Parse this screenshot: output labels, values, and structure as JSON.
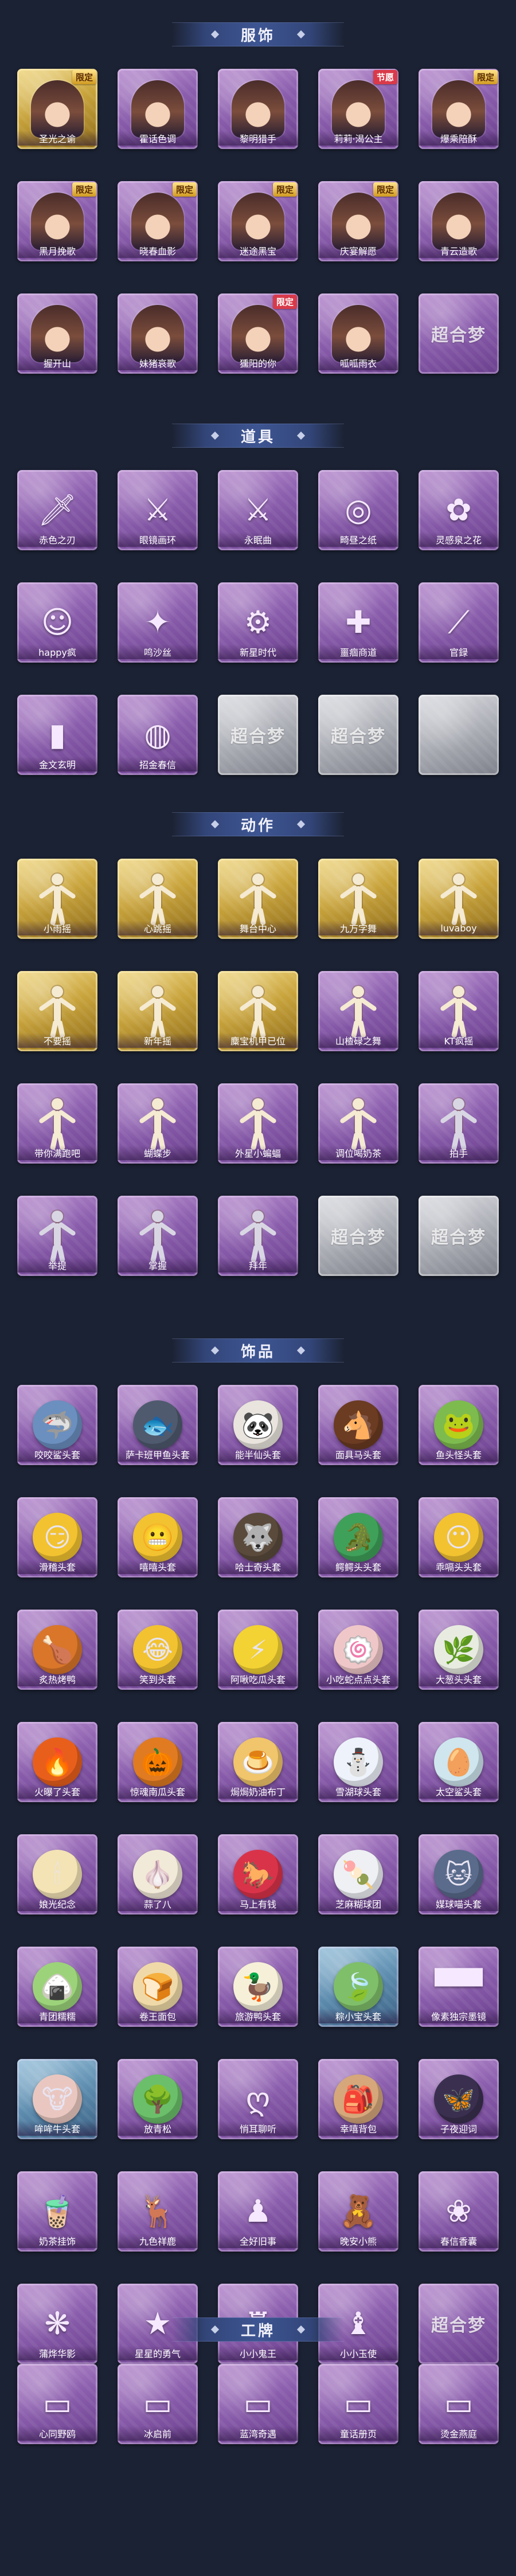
{
  "sections": [
    {
      "title": "服饰",
      "items": [
        {
          "label": "圣光之谕",
          "badge": "限定",
          "badge_style": "gold",
          "tone": "gold",
          "kind": "portrait",
          "icon": "costume-portrait"
        },
        {
          "label": "霍话色调",
          "badge": "",
          "tone": "purple",
          "kind": "portrait",
          "icon": "costume-portrait"
        },
        {
          "label": "黎明猎手",
          "badge": "",
          "tone": "purple",
          "kind": "portrait",
          "icon": "costume-portrait"
        },
        {
          "label": "莉莉·渴公主",
          "badge": "节愿",
          "badge_style": "red",
          "tone": "purple",
          "kind": "portrait",
          "icon": "costume-portrait"
        },
        {
          "label": "爆乘陪酥",
          "badge": "限定",
          "badge_style": "gold",
          "tone": "purple",
          "kind": "portrait",
          "icon": "costume-portrait"
        },
        {
          "label": "黑月挽歌",
          "badge": "限定",
          "badge_style": "gold",
          "tone": "purple",
          "kind": "portrait",
          "icon": "costume-portrait"
        },
        {
          "label": "晓春血影",
          "badge": "限定",
          "badge_style": "gold",
          "tone": "purple",
          "kind": "portrait",
          "icon": "costume-portrait"
        },
        {
          "label": "迷途黑宝",
          "badge": "限定",
          "badge_style": "gold",
          "tone": "purple",
          "kind": "portrait",
          "icon": "costume-portrait"
        },
        {
          "label": "庆宴解愿",
          "badge": "限定",
          "badge_style": "gold",
          "tone": "purple",
          "kind": "portrait",
          "icon": "costume-portrait"
        },
        {
          "label": "青云造歌",
          "badge": "",
          "tone": "purple",
          "kind": "portrait",
          "icon": "costume-portrait"
        },
        {
          "label": "握开山",
          "badge": "",
          "tone": "purple",
          "kind": "portrait",
          "icon": "costume-portrait"
        },
        {
          "label": "妹猪哀歌",
          "badge": "",
          "tone": "purple",
          "kind": "portrait",
          "icon": "costume-portrait"
        },
        {
          "label": "獯阳的你",
          "badge": "限定",
          "badge_style": "red",
          "tone": "purple",
          "kind": "portrait",
          "icon": "costume-portrait"
        },
        {
          "label": "呱呱雨衣",
          "badge": "",
          "tone": "purple",
          "kind": "portrait",
          "icon": "costume-portrait"
        },
        {
          "label": "",
          "badge": "",
          "tone": "purple",
          "kind": "logo",
          "logo_text": "超合梦",
          "icon": "placeholder-logo"
        }
      ]
    },
    {
      "title": "道具",
      "items": [
        {
          "label": "赤色之刃",
          "badge": "",
          "tone": "purple",
          "kind": "prop",
          "glyph": "🗡",
          "icon": "blade-icon"
        },
        {
          "label": "眼镜画环",
          "badge": "",
          "tone": "purple",
          "kind": "prop",
          "glyph": "⚔",
          "icon": "weapon-icon"
        },
        {
          "label": "永眠曲",
          "badge": "",
          "tone": "purple",
          "kind": "prop",
          "glyph": "⚔",
          "icon": "weapon-icon"
        },
        {
          "label": "畸昼之纸",
          "badge": "",
          "tone": "purple",
          "kind": "prop",
          "glyph": "◎",
          "icon": "ring-icon"
        },
        {
          "label": "灵感泉之花",
          "badge": "",
          "tone": "purple",
          "kind": "prop",
          "glyph": "✿",
          "icon": "flower-icon"
        },
        {
          "label": "happy疯",
          "badge": "",
          "tone": "purple",
          "kind": "prop",
          "glyph": "☺",
          "icon": "doll-icon"
        },
        {
          "label": "鸣沙丝",
          "badge": "",
          "tone": "purple",
          "kind": "prop",
          "glyph": "✦",
          "icon": "charm-icon"
        },
        {
          "label": "新星时代",
          "badge": "",
          "tone": "purple",
          "kind": "prop",
          "glyph": "⚙",
          "icon": "gun-icon"
        },
        {
          "label": "噩痼商道",
          "badge": "",
          "tone": "purple",
          "kind": "prop",
          "glyph": "✚",
          "icon": "medkit-icon"
        },
        {
          "label": "官録",
          "badge": "",
          "tone": "purple",
          "kind": "prop",
          "glyph": "⟋",
          "icon": "staff-icon"
        },
        {
          "label": "金文玄明",
          "badge": "",
          "tone": "purple",
          "kind": "prop",
          "glyph": "▮",
          "icon": "canister-icon"
        },
        {
          "label": "招金春信",
          "badge": "",
          "tone": "purple",
          "kind": "prop",
          "glyph": "◍",
          "icon": "fan-icon"
        },
        {
          "label": "",
          "badge": "",
          "tone": "grey",
          "kind": "logo",
          "logo_text": "超合梦",
          "icon": "placeholder-logo"
        },
        {
          "label": "",
          "badge": "",
          "tone": "grey",
          "kind": "logo",
          "logo_text": "超合梦",
          "icon": "placeholder-logo"
        },
        {
          "label": "",
          "badge": "",
          "tone": "grey",
          "kind": "logo",
          "logo_text": "",
          "icon": "placeholder-logo"
        }
      ]
    },
    {
      "title": "动作",
      "items": [
        {
          "label": "小雨摇",
          "badge": "",
          "tone": "gold",
          "kind": "pose",
          "icon": "pose-figure-icon"
        },
        {
          "label": "心跳摇",
          "badge": "",
          "tone": "gold",
          "kind": "pose",
          "icon": "pose-figure-icon"
        },
        {
          "label": "舞台中心",
          "badge": "",
          "tone": "gold",
          "kind": "pose",
          "icon": "pose-figure-icon"
        },
        {
          "label": "九万字舞",
          "badge": "",
          "tone": "gold",
          "kind": "pose",
          "icon": "pose-figure-icon"
        },
        {
          "label": "luvaboy",
          "badge": "",
          "tone": "gold",
          "kind": "pose",
          "icon": "pose-figure-icon"
        },
        {
          "label": "不要摇",
          "badge": "",
          "tone": "gold",
          "kind": "pose",
          "icon": "pose-figure-icon"
        },
        {
          "label": "新年摇",
          "badge": "",
          "tone": "gold",
          "kind": "pose",
          "icon": "pose-figure-icon"
        },
        {
          "label": "麋宝机甲已位",
          "badge": "",
          "tone": "gold",
          "kind": "pose",
          "icon": "pose-figure-icon"
        },
        {
          "label": "山楂碌之舞",
          "badge": "",
          "tone": "purple",
          "kind": "pose",
          "icon": "pose-figure-icon"
        },
        {
          "label": "KT疯摇",
          "badge": "",
          "tone": "purple",
          "kind": "pose",
          "icon": "pose-figure-icon"
        },
        {
          "label": "带你满跑吧",
          "badge": "",
          "tone": "purple",
          "kind": "pose",
          "icon": "pose-figure-icon"
        },
        {
          "label": "蝴蝶步",
          "badge": "",
          "tone": "purple",
          "kind": "pose",
          "icon": "pose-figure-icon"
        },
        {
          "label": "外星小蝙蝠",
          "badge": "",
          "tone": "purple",
          "kind": "pose",
          "icon": "pose-figure-icon"
        },
        {
          "label": "调位喝奶茶",
          "badge": "",
          "tone": "purple",
          "kind": "pose",
          "icon": "pose-figure-icon"
        },
        {
          "label": "拍手",
          "badge": "",
          "tone": "purple",
          "kind": "pose",
          "faded": true,
          "icon": "pose-figure-icon"
        },
        {
          "label": "举提",
          "badge": "",
          "tone": "purple",
          "kind": "pose",
          "faded": true,
          "icon": "pose-figure-icon"
        },
        {
          "label": "掌握",
          "badge": "",
          "tone": "purple",
          "kind": "pose",
          "faded": true,
          "icon": "pose-figure-icon"
        },
        {
          "label": "拜年",
          "badge": "",
          "tone": "purple",
          "kind": "pose",
          "faded": true,
          "icon": "pose-figure-icon"
        },
        {
          "label": "",
          "badge": "",
          "tone": "grey",
          "kind": "logo",
          "logo_text": "超合梦",
          "icon": "placeholder-logo"
        },
        {
          "label": "",
          "badge": "",
          "tone": "grey",
          "kind": "logo",
          "logo_text": "超合梦",
          "icon": "placeholder-logo"
        }
      ]
    },
    {
      "title": "饰品",
      "items": [
        {
          "label": "咬咬鲨头套",
          "tone": "purple",
          "kind": "blob",
          "glyph": "🦈",
          "blob_color": "#6b8fbf",
          "icon": "shark-headgear-icon"
        },
        {
          "label": "萨卡班甲鱼头套",
          "tone": "purple",
          "kind": "blob",
          "glyph": "🐟",
          "blob_color": "#4f5a6e",
          "icon": "fish-headgear-icon"
        },
        {
          "label": "能半仙头套",
          "tone": "purple",
          "kind": "blob",
          "glyph": "🐼",
          "blob_color": "#e9e4dd",
          "icon": "panda-headgear-icon"
        },
        {
          "label": "面具马头套",
          "tone": "purple",
          "kind": "blob",
          "glyph": "🐴",
          "blob_color": "#6b3b22",
          "icon": "horse-headgear-icon"
        },
        {
          "label": "鱼头怪头套",
          "tone": "purple",
          "kind": "blob",
          "glyph": "🐸",
          "blob_color": "#7dbb4f",
          "icon": "fishhead-headgear-icon"
        },
        {
          "label": "滑稽头套",
          "tone": "purple",
          "kind": "blob",
          "glyph": "😏",
          "blob_color": "#f2c230",
          "icon": "smirk-headgear-icon"
        },
        {
          "label": "嘻嘻头套",
          "tone": "purple",
          "kind": "blob",
          "glyph": "😬",
          "blob_color": "#f2c230",
          "icon": "grin-headgear-icon"
        },
        {
          "label": "哈士奇头套",
          "tone": "purple",
          "kind": "blob",
          "glyph": "🐺",
          "blob_color": "#5a4a3c",
          "icon": "husky-headgear-icon"
        },
        {
          "label": "鳄鳄头头套",
          "tone": "purple",
          "kind": "blob",
          "glyph": "🐊",
          "blob_color": "#3fa05a",
          "icon": "croc-headgear-icon"
        },
        {
          "label": "乖嗝头头套",
          "tone": "purple",
          "kind": "blob",
          "glyph": "😶",
          "blob_color": "#f2c230",
          "icon": "face-headgear-icon"
        },
        {
          "label": "炙热烤鸭",
          "tone": "purple",
          "kind": "blob",
          "glyph": "🍗",
          "blob_color": "#d9762a",
          "icon": "toast-headgear-icon"
        },
        {
          "label": "笑到头套",
          "tone": "purple",
          "kind": "blob",
          "glyph": "😂",
          "blob_color": "#f2c230",
          "icon": "laugh-headgear-icon"
        },
        {
          "label": "阿啾吃瓜头套",
          "tone": "purple",
          "kind": "blob",
          "glyph": "⚡",
          "blob_color": "#f3d233",
          "icon": "pika-headgear-icon"
        },
        {
          "label": "小吃蛇点点头套",
          "tone": "purple",
          "kind": "blob",
          "glyph": "🍥",
          "blob_color": "#f0c7c8",
          "icon": "swirl-headgear-icon"
        },
        {
          "label": "大葱头头套",
          "tone": "purple",
          "kind": "blob",
          "glyph": "🌿",
          "blob_color": "#e8ece0",
          "icon": "scallion-headgear-icon"
        },
        {
          "label": "火曝了头套",
          "tone": "purple",
          "kind": "blob",
          "glyph": "🔥",
          "blob_color": "#e85f1c",
          "icon": "fire-headgear-icon"
        },
        {
          "label": "惊魂南瓜头套",
          "tone": "purple",
          "kind": "blob",
          "glyph": "🎃",
          "blob_color": "#e07b22",
          "icon": "pumpkin-headgear-icon"
        },
        {
          "label": "焗焗奶油布丁",
          "tone": "purple",
          "kind": "blob",
          "glyph": "🍮",
          "blob_color": "#f0c56b",
          "icon": "pudding-headgear-icon"
        },
        {
          "label": "雪湖球头套",
          "tone": "purple",
          "kind": "blob",
          "glyph": "⛄",
          "blob_color": "#eef3fb",
          "icon": "snowman-headgear-icon"
        },
        {
          "label": "太空鲨头套",
          "tone": "purple",
          "kind": "blob",
          "glyph": "🥚",
          "blob_color": "#cfe6ee",
          "icon": "egg-headgear-icon"
        },
        {
          "label": "娘光纪念",
          "tone": "purple",
          "kind": "blob",
          "glyph": "🕯",
          "blob_color": "#f3e3b5",
          "icon": "candle-headgear-icon"
        },
        {
          "label": "蒜了八",
          "tone": "purple",
          "kind": "blob",
          "glyph": "🧄",
          "blob_color": "#f2ead8",
          "icon": "garlic-headgear-icon"
        },
        {
          "label": "马上有钱",
          "tone": "purple",
          "kind": "blob",
          "glyph": "🐎",
          "blob_color": "#d9334a",
          "icon": "money-horse-headgear-icon"
        },
        {
          "label": "芝麻糊球团",
          "tone": "purple",
          "kind": "blob",
          "glyph": "🍡",
          "blob_color": "#eef0f4",
          "icon": "dumpling-headgear-icon"
        },
        {
          "label": "媒球喵头套",
          "tone": "purple",
          "kind": "blob",
          "glyph": "🐱",
          "blob_color": "#5a6b8c",
          "icon": "cat-headgear-icon"
        },
        {
          "label": "青团糯糯",
          "tone": "purple",
          "kind": "blob",
          "glyph": "🍙",
          "blob_color": "#9cd37a",
          "icon": "qingtuan-headgear-icon"
        },
        {
          "label": "卷王面包",
          "tone": "purple",
          "kind": "blob",
          "glyph": "🍞",
          "blob_color": "#f0d9a8",
          "icon": "bread-headgear-icon"
        },
        {
          "label": "旅游鸭头套",
          "tone": "purple",
          "kind": "blob",
          "glyph": "🦆",
          "blob_color": "#f6f0d8",
          "icon": "duck-headgear-icon"
        },
        {
          "label": "粽小宝头套",
          "tone": "blue",
          "kind": "blob",
          "glyph": "🍃",
          "blob_color": "#7fbf6a",
          "icon": "zongzi-headgear-icon"
        },
        {
          "label": "像素独宗墨镜",
          "tone": "purple",
          "kind": "prop",
          "glyph": "▀▀",
          "icon": "pixel-sunglasses-icon"
        },
        {
          "label": "哞哞牛头套",
          "tone": "blue",
          "kind": "blob",
          "glyph": "🐮",
          "blob_color": "#e9c7c0",
          "icon": "cow-headgear-icon"
        },
        {
          "label": "放青松",
          "tone": "purple",
          "kind": "blob",
          "glyph": "🌳",
          "blob_color": "#6bbf6a",
          "icon": "pine-headgear-icon"
        },
        {
          "label": "悄耳聊听",
          "tone": "purple",
          "kind": "prop",
          "glyph": "ღ",
          "icon": "pendant-icon"
        },
        {
          "label": "幸嘻背包",
          "tone": "purple",
          "kind": "blob",
          "glyph": "🎒",
          "blob_color": "#d5a77a",
          "icon": "backpack-icon"
        },
        {
          "label": "子夜迎词",
          "tone": "purple",
          "kind": "blob",
          "glyph": "🦋",
          "blob_color": "#3a2f4f",
          "icon": "midnight-icon"
        },
        {
          "label": "奶茶挂饰",
          "tone": "purple",
          "kind": "prop",
          "glyph": "🧋",
          "icon": "milktea-charm-icon"
        },
        {
          "label": "九色祥鹿",
          "tone": "purple",
          "kind": "prop",
          "glyph": "🦌",
          "icon": "deer-charm-icon"
        },
        {
          "label": "全好旧事",
          "tone": "purple",
          "kind": "prop",
          "glyph": "♟",
          "icon": "figure-charm-icon"
        },
        {
          "label": "晚安小熊",
          "tone": "purple",
          "kind": "prop",
          "glyph": "🧸",
          "icon": "bear-charm-icon"
        },
        {
          "label": "春信香囊",
          "tone": "purple",
          "kind": "prop",
          "glyph": "❀",
          "icon": "sachet-charm-icon"
        },
        {
          "label": "蒲烨华影",
          "tone": "purple",
          "kind": "prop",
          "glyph": "❋",
          "icon": "flower-charm-icon"
        },
        {
          "label": "星星的勇气",
          "tone": "purple",
          "kind": "prop",
          "glyph": "★",
          "icon": "star-charm-icon"
        },
        {
          "label": "小小鬼王",
          "tone": "purple",
          "kind": "prop",
          "glyph": "♜",
          "icon": "ghost-king-charm-icon"
        },
        {
          "label": "小小玉使",
          "tone": "purple",
          "kind": "prop",
          "glyph": "♝",
          "icon": "envoy-charm-icon"
        },
        {
          "label": "",
          "tone": "purple",
          "kind": "logo",
          "logo_text": "超合梦",
          "icon": "placeholder-logo"
        }
      ]
    },
    {
      "title": "工牌",
      "items": [
        {
          "label": "心同野鸥",
          "tone": "purple",
          "kind": "prop",
          "glyph": "▭",
          "icon": "badge-card-icon"
        },
        {
          "label": "冰启前",
          "tone": "purple",
          "kind": "prop",
          "glyph": "▭",
          "icon": "badge-card-icon"
        },
        {
          "label": "蓝湾奇遇",
          "tone": "purple",
          "kind": "prop",
          "glyph": "▭",
          "icon": "badge-card-icon"
        },
        {
          "label": "童话册页",
          "tone": "purple",
          "kind": "prop",
          "glyph": "▭",
          "icon": "badge-card-icon"
        },
        {
          "label": "烫金燕庭",
          "tone": "purple",
          "kind": "prop",
          "glyph": "▭",
          "icon": "badge-card-icon"
        }
      ]
    }
  ]
}
